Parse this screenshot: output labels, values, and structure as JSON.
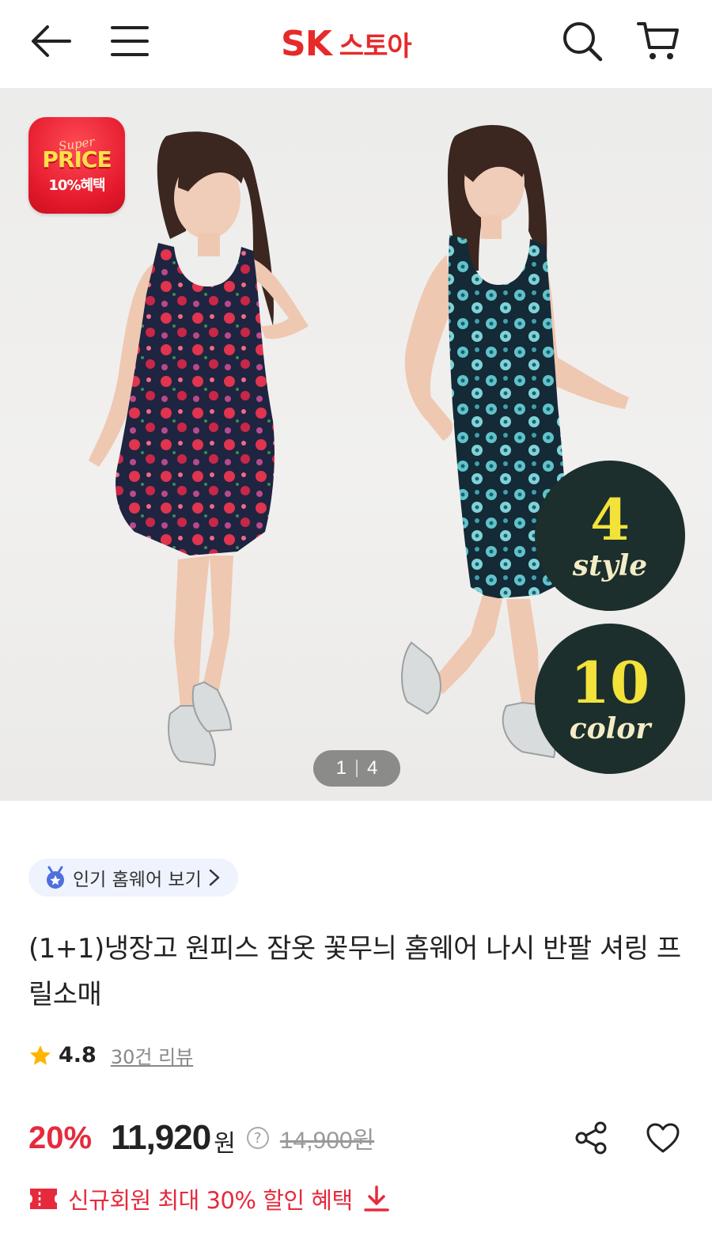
{
  "header": {
    "logo_sk": "SK",
    "logo_store": "스토아",
    "brand_color": "#e62a2a",
    "icons": [
      "back-arrow-icon",
      "menu-icon",
      "search-icon",
      "cart-icon"
    ]
  },
  "hero": {
    "badge": {
      "super": "Super",
      "price": "PRICE",
      "benefit": "10%혜택"
    },
    "style_badge": {
      "number": "4",
      "word": "style"
    },
    "color_badge": {
      "number": "10",
      "word": "color"
    },
    "pager": {
      "current": "1",
      "total": "4"
    }
  },
  "product": {
    "category_chip": "인기 홈웨어 보기",
    "title": "(1+1)냉장고 원피스 잠옷 꽃무늬 홈웨어 나시 반팔 셔링 프릴소매",
    "rating": "4.8",
    "reviews": "30건 리뷰",
    "discount": "20%",
    "price": "11,920",
    "price_unit": "원",
    "original_price": "14,900원",
    "coupon_text": "신규회원 최대 30% 할인 혜택",
    "accent_color": "#e62a3c"
  }
}
